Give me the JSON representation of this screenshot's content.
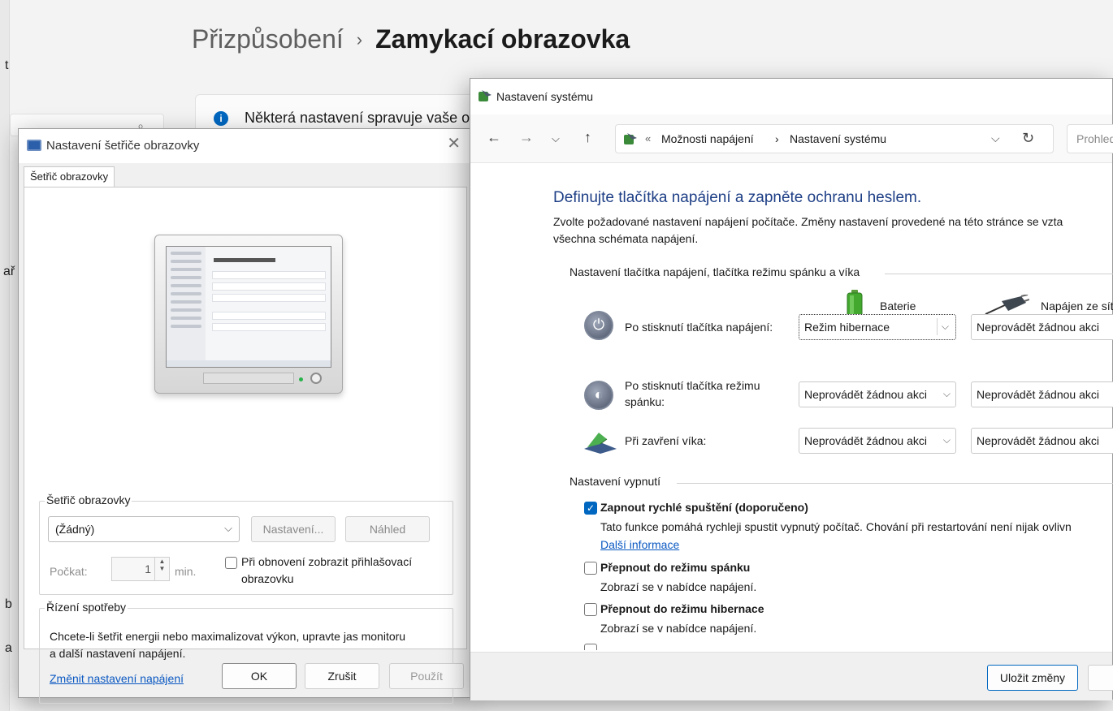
{
  "background_app": {
    "breadcrumb_parent": "Přizpůsobení",
    "breadcrumb_separator": "›",
    "breadcrumb_current": "Zamykací obrazovka",
    "info_text": "Některá nastavení spravuje vaše or",
    "fragments": [
      "t",
      "ař",
      "b",
      "a"
    ]
  },
  "screensaver_dialog": {
    "title": "Nastavení šetřiče obrazovky",
    "tab": "Šetřič obrazovky",
    "group_screensaver": {
      "legend": "Šetřič obrazovky",
      "selected": "(Žádný)",
      "settings_button": "Nastavení...",
      "preview_button": "Náhled",
      "wait_label": "Počkat:",
      "wait_value": "1",
      "wait_unit": "min.",
      "resume_checkbox": "Při obnovení zobrazit přihlašovací obrazovku"
    },
    "group_power": {
      "legend": "Řízení spotřeby",
      "text": "Chcete-li šetřit energii nebo maximalizovat výkon, upravte jas monitoru a další nastavení napájení.",
      "link": "Změnit nastavení napájení"
    },
    "buttons": {
      "ok": "OK",
      "cancel": "Zrušit",
      "apply": "Použít"
    }
  },
  "system_window": {
    "title": "Nastavení systému",
    "address": {
      "chevron": "«",
      "crumb1": "Možnosti napájení",
      "separator": "›",
      "crumb2": "Nastavení systému"
    },
    "search_placeholder": "Prohledat",
    "heading": "Definujte tlačítka napájení a zapněte ochranu heslem.",
    "description_line1": "Zvolte požadované nastavení napájení počítače. Změny nastavení provedené na této stránce se vzta",
    "description_line2": "všechna schémata napájení.",
    "section_buttons": "Nastavení tlačítka napájení, tlačítka režimu spánku a víka",
    "column_battery": "Baterie",
    "column_ac": "Napájen ze sítě",
    "rows": [
      {
        "label": "Po stisknutí tlačítka napájení:",
        "battery": "Režim hibernace",
        "ac": "Neprovádět žádnou akci"
      },
      {
        "label": "Po stisknutí tlačítka režimu spánku:",
        "battery": "Neprovádět žádnou akci",
        "ac": "Neprovádět žádnou akci"
      },
      {
        "label": "Při zavření víka:",
        "battery": "Neprovádět žádnou akci",
        "ac": "Neprovádět žádnou akci"
      }
    ],
    "section_shutdown": "Nastavení vypnutí",
    "options": [
      {
        "title": "Zapnout rychlé spuštění (doporučeno)",
        "checked": true,
        "sub": "Tato funkce pomáhá rychleji spustit vypnutý počítač. Chování při restartování není nijak ovlivn",
        "link": "Další informace"
      },
      {
        "title": "Přepnout do režimu spánku",
        "checked": false,
        "sub": "Zobrazí se v nabídce napájení."
      },
      {
        "title": "Přepnout do režimu hibernace",
        "checked": false,
        "sub": "Zobrazí se v nabídce napájení."
      }
    ],
    "save_button": "Uložit změny"
  },
  "colors": {
    "accent": "#0067c0",
    "heading_blue": "#1e3f86",
    "link_blue": "#0a58c2"
  }
}
